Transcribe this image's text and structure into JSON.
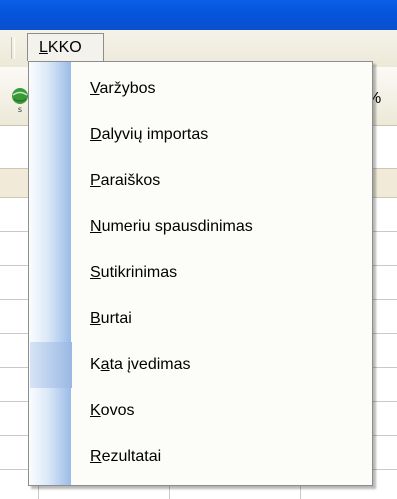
{
  "menubar": {
    "menu_title": "LKKO"
  },
  "toolbar": {
    "zoom_suffix": "%",
    "icon": "globe-icon"
  },
  "dropdown": {
    "items": [
      {
        "accel": "V",
        "rest": "aržybos"
      },
      {
        "accel": "D",
        "rest": "alyvių importas"
      },
      {
        "accel": "P",
        "rest": "araiškos"
      },
      {
        "accel": "N",
        "rest": "umeriu spausdinimas"
      },
      {
        "accel": "S",
        "rest": "utikrinimas"
      },
      {
        "accel": "B",
        "rest": "urtai"
      },
      {
        "pre": "K",
        "accel": "a",
        "rest": "ta įvedimas",
        "highlighted": true
      },
      {
        "accel": "K",
        "rest": "ovos"
      },
      {
        "accel": "R",
        "rest": "ezultatai"
      }
    ]
  },
  "colors": {
    "titlebar": "#0554dc",
    "menubar": "#ece9d8",
    "gutter_gradient_end": "#9bbbe8",
    "column_header": "#f1ead8"
  }
}
